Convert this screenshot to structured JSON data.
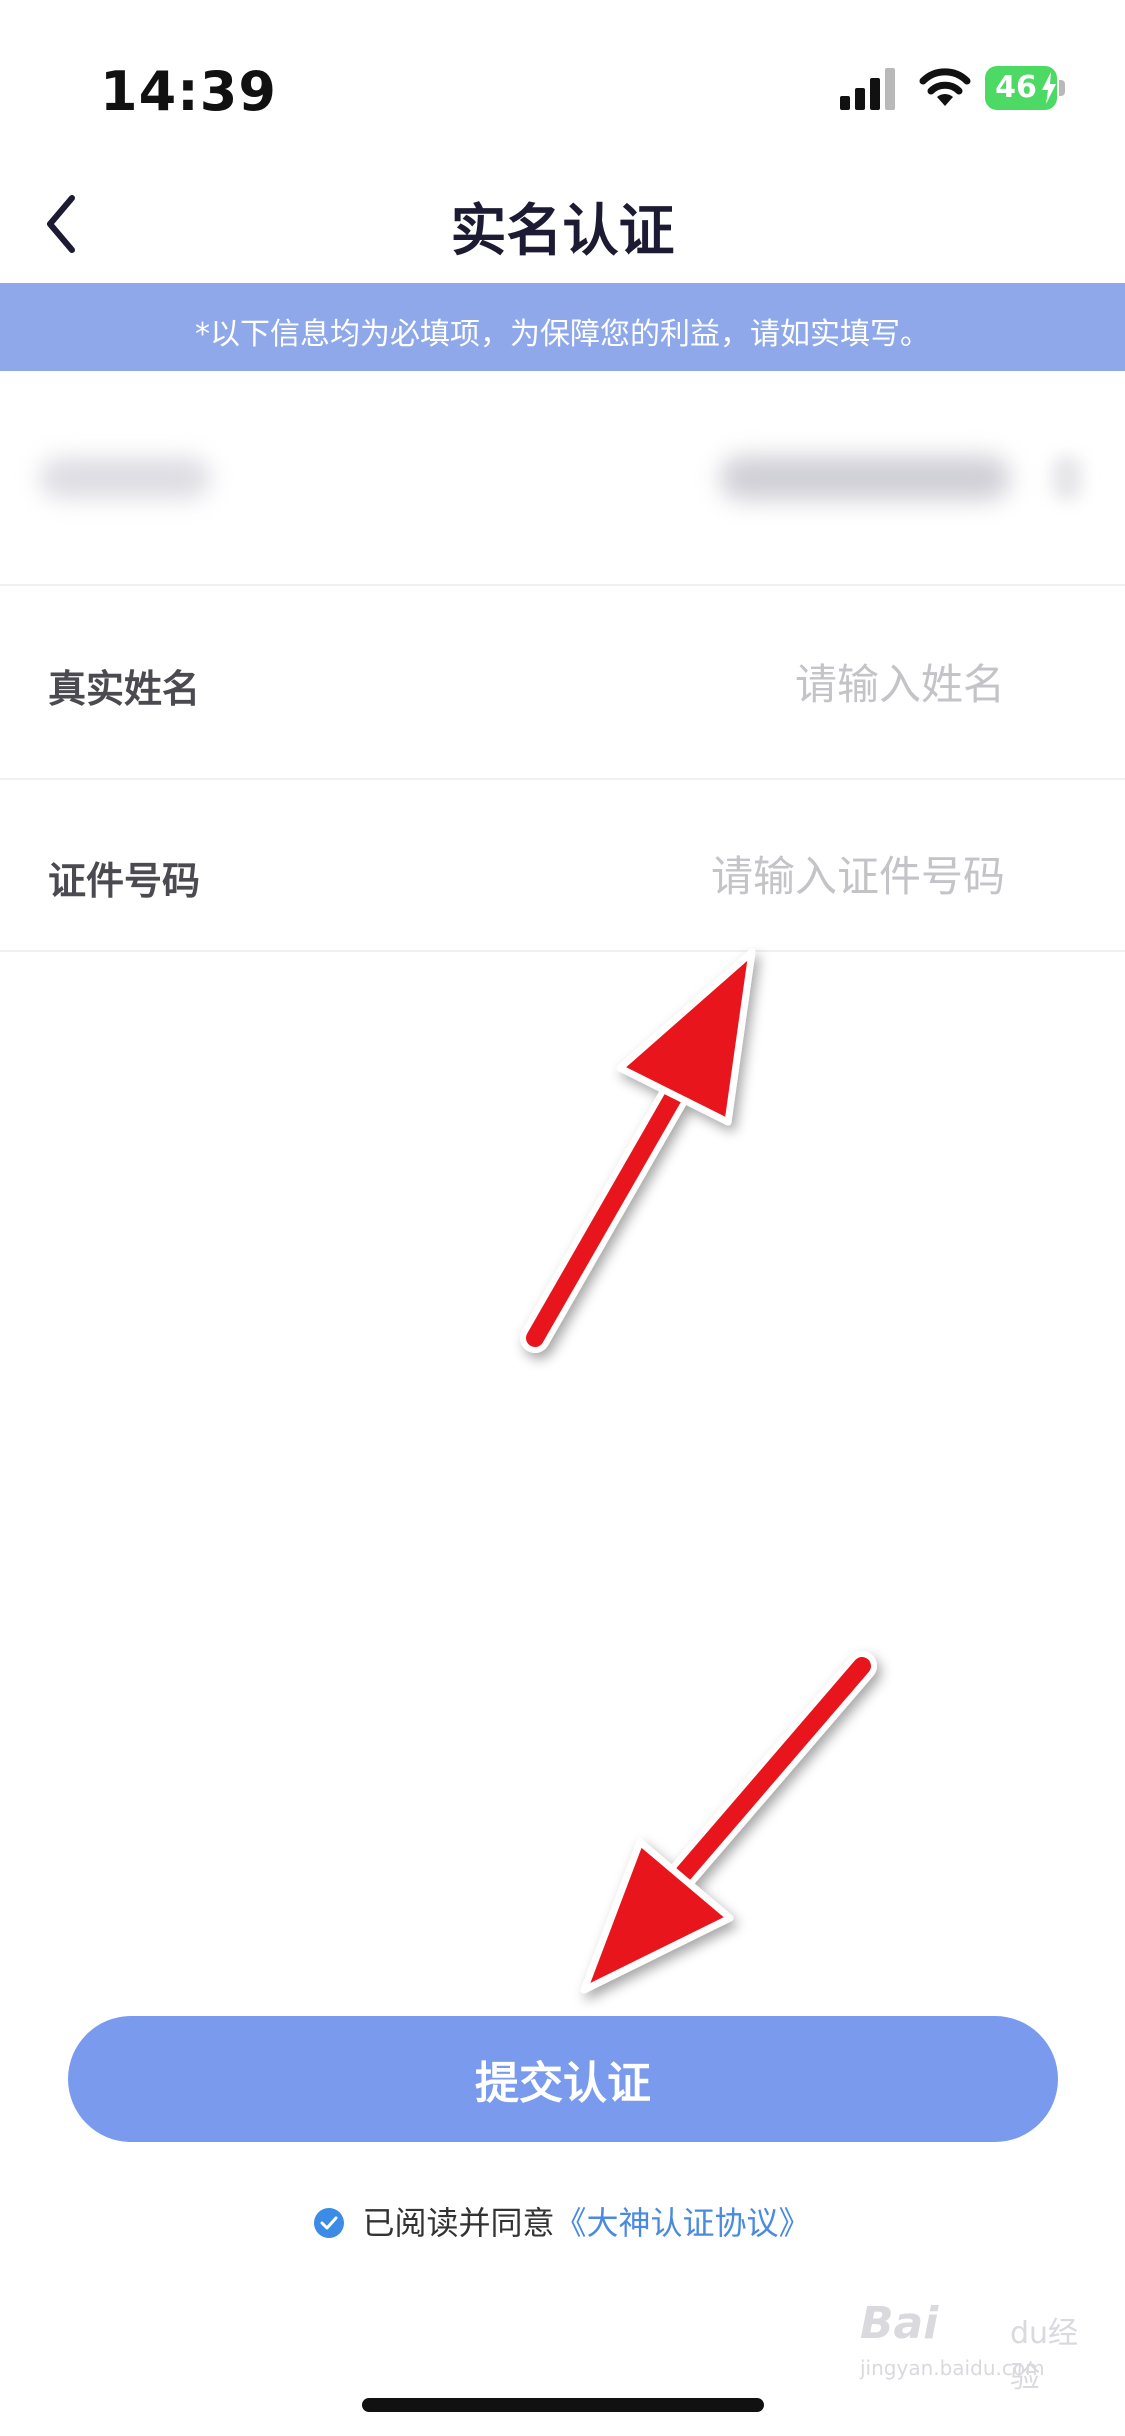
{
  "status_bar": {
    "time": "14:39",
    "battery_level": "46",
    "battery_color": "#4cd964"
  },
  "nav": {
    "back_icon": "chevron-left-icon",
    "title": "实名认证"
  },
  "notice": {
    "text": "*以下信息均为必填项，为保障您的利益，请如实填写。",
    "background": "#8ea8ea"
  },
  "form": {
    "name": {
      "label": "真实姓名",
      "value": "",
      "placeholder": "请输入姓名"
    },
    "id_number": {
      "label": "证件号码",
      "value": "",
      "placeholder": "请输入证件号码"
    }
  },
  "submit": {
    "label": "提交认证",
    "color": "#7a9aee"
  },
  "agreement": {
    "prefix": "已阅读并同意",
    "link": "《大神认证协议》",
    "checked": true
  },
  "watermark": {
    "brand": "Bai",
    "suffix": "du经验",
    "site": "jingyan.baidu.com"
  },
  "annotation_color": "#e8141a"
}
